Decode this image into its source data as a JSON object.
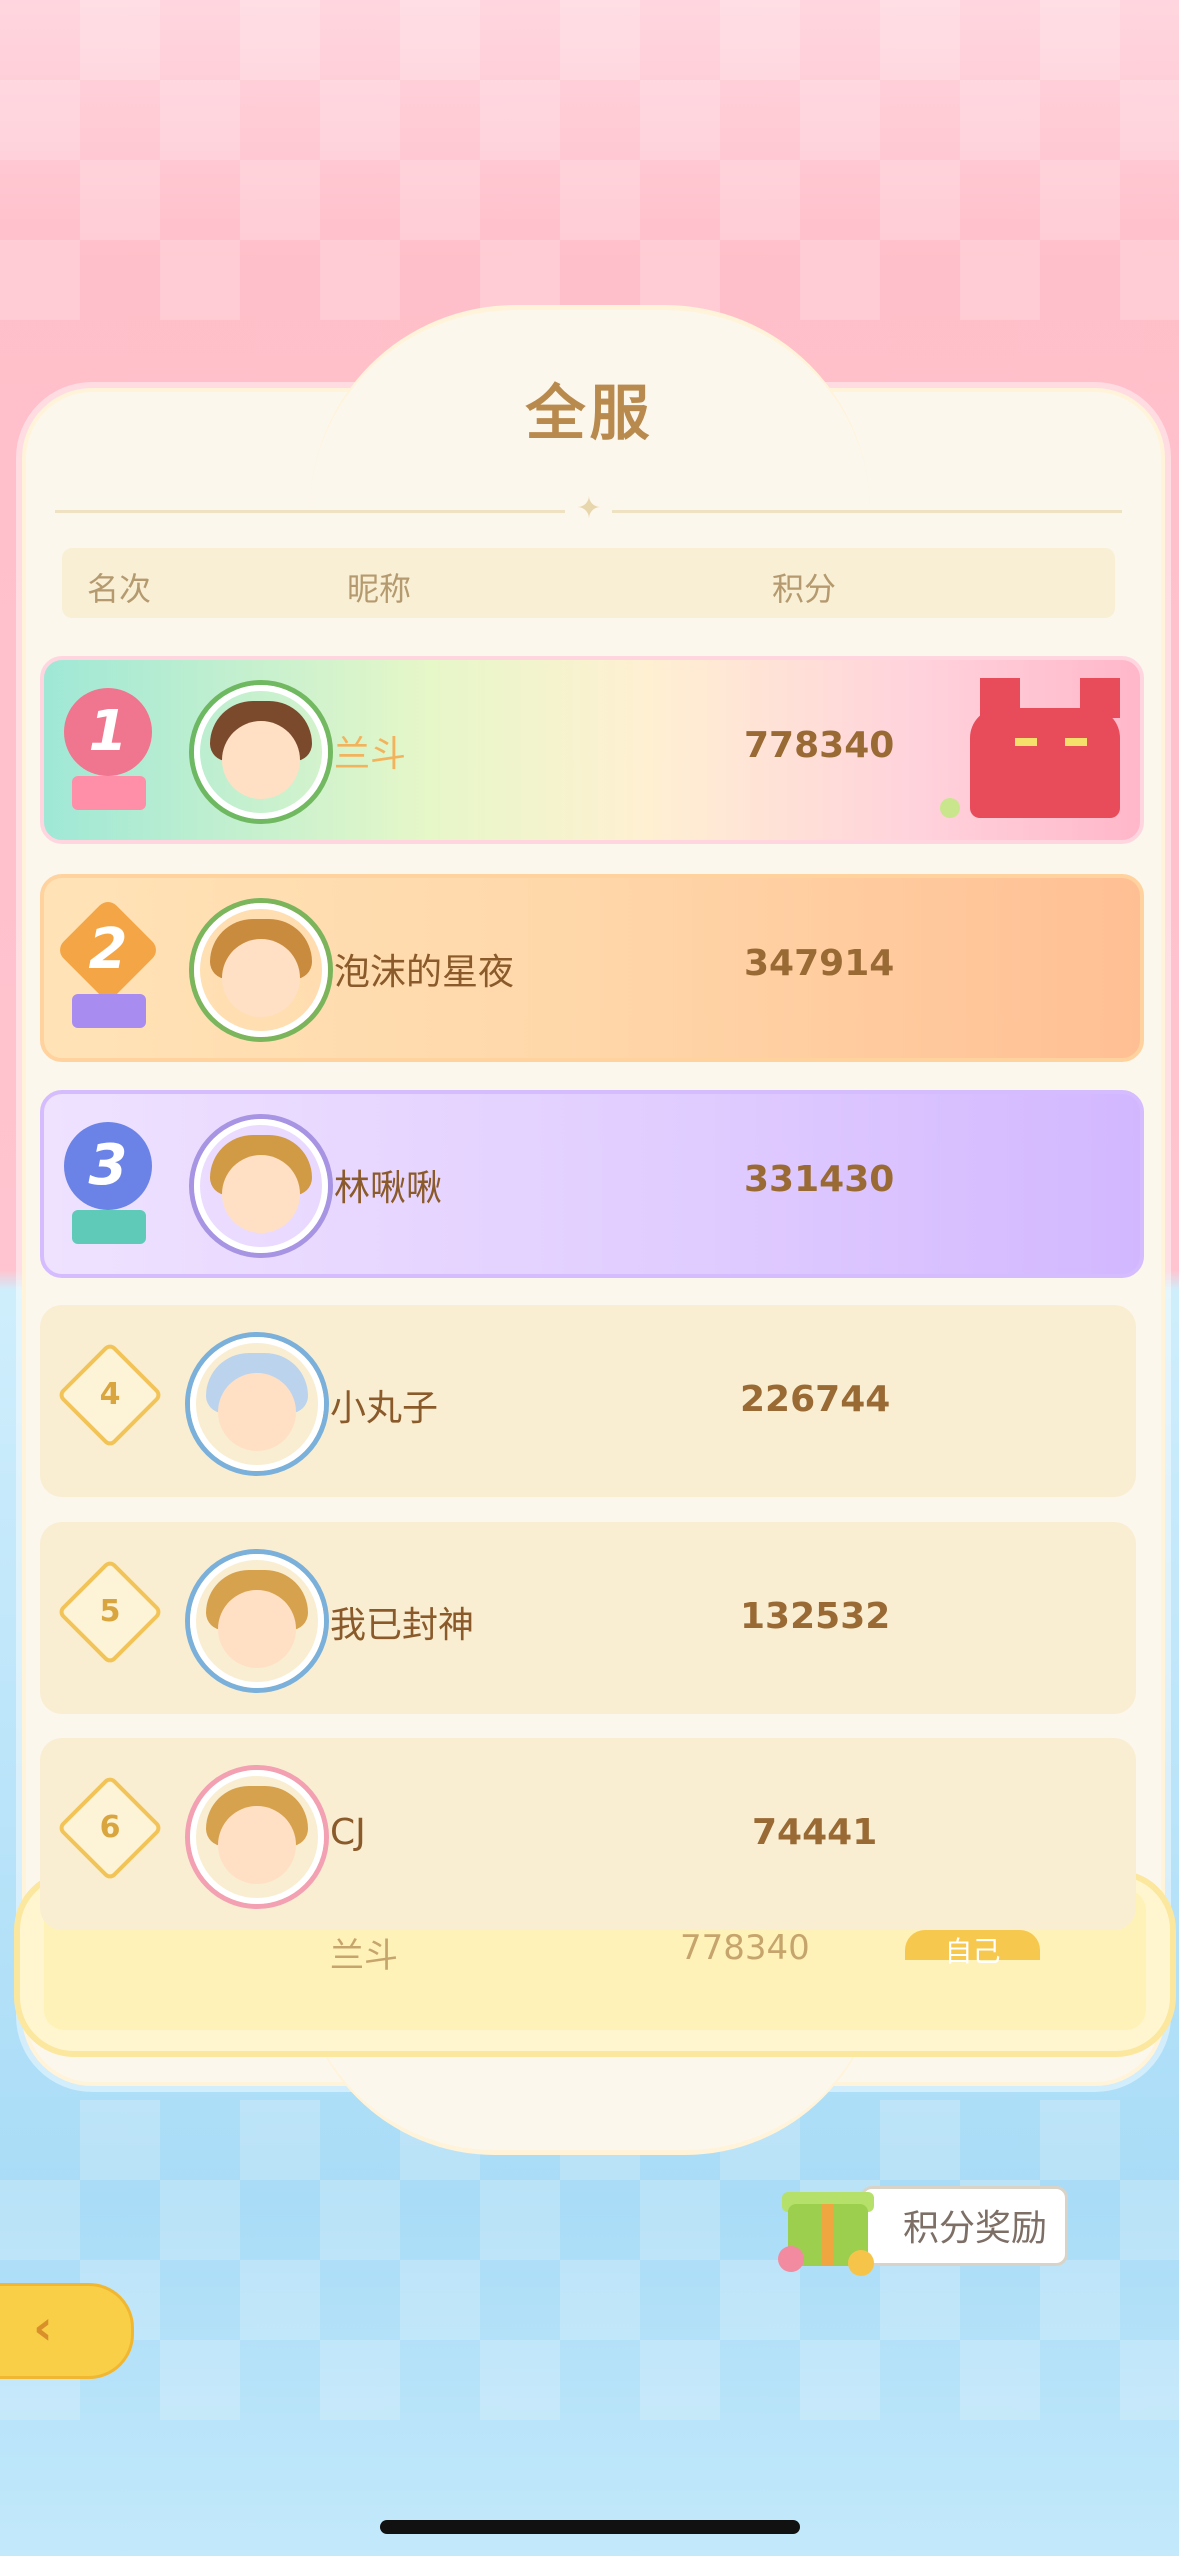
{
  "title": "全服",
  "columns": {
    "rank": "名次",
    "nickname": "昵称",
    "score": "积分"
  },
  "rows": [
    {
      "rank": "1",
      "name": "兰斗",
      "score": "778340"
    },
    {
      "rank": "2",
      "name": "泡沫的星夜",
      "score": "347914"
    },
    {
      "rank": "3",
      "name": "林啾啾",
      "score": "331430"
    },
    {
      "rank": "4",
      "name": "小丸子",
      "score": "226744"
    },
    {
      "rank": "5",
      "name": "我已封神",
      "score": "132532"
    },
    {
      "rank": "6",
      "name": "CJ",
      "score": "74441"
    }
  ],
  "self": {
    "name": "兰斗",
    "score": "778340",
    "tag": "自己"
  },
  "reward_button": "积分奖励",
  "colors": {
    "gold": "#b98a4e",
    "pink": "#ffbfca",
    "blue": "#a9dcf7"
  },
  "icons": {
    "back": "back-arrow-icon",
    "gift": "gift-icon"
  }
}
